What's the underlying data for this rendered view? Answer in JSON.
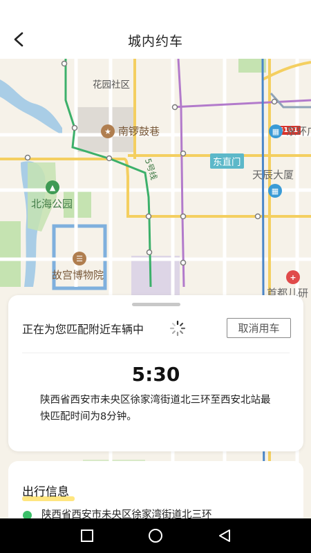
{
  "header": {
    "title": "城内约车",
    "back_icon": "chevron-left-icon"
  },
  "map": {
    "labels": {
      "huayuan": "花园社区",
      "nanluoguxiang": "南锣鼓巷",
      "dongzhimen": "东直门",
      "dongsihuan": "东环广",
      "tianchen": "天辰大厦",
      "beihai": "北海公园",
      "gugong": "故宫博物院",
      "shoudu": "首都儿研",
      "line5": "5号线",
      "road": "G101"
    },
    "colors": {
      "water": "#a9cde6",
      "park": "#c5e3b1",
      "main_road": "#f4cf60",
      "metro_green": "#3cb06a",
      "metro_purple": "#b27acb",
      "metro_blue": "#4a86c9"
    }
  },
  "matching_card": {
    "status_text": "正在为您匹配附近车辆中",
    "cancel_label": "取消用车",
    "countdown": "5:30",
    "description": "陕西省西安市未央区徐家湾街道北三环至西安北站最快匹配时间为8分钟。"
  },
  "trip_card": {
    "title": "出行信息",
    "start_address": "陕西省西安市未央区徐家湾街道北三环"
  },
  "system_nav": {
    "recents_icon": "square-icon",
    "home_icon": "circle-icon",
    "back_icon": "triangle-back-icon"
  }
}
